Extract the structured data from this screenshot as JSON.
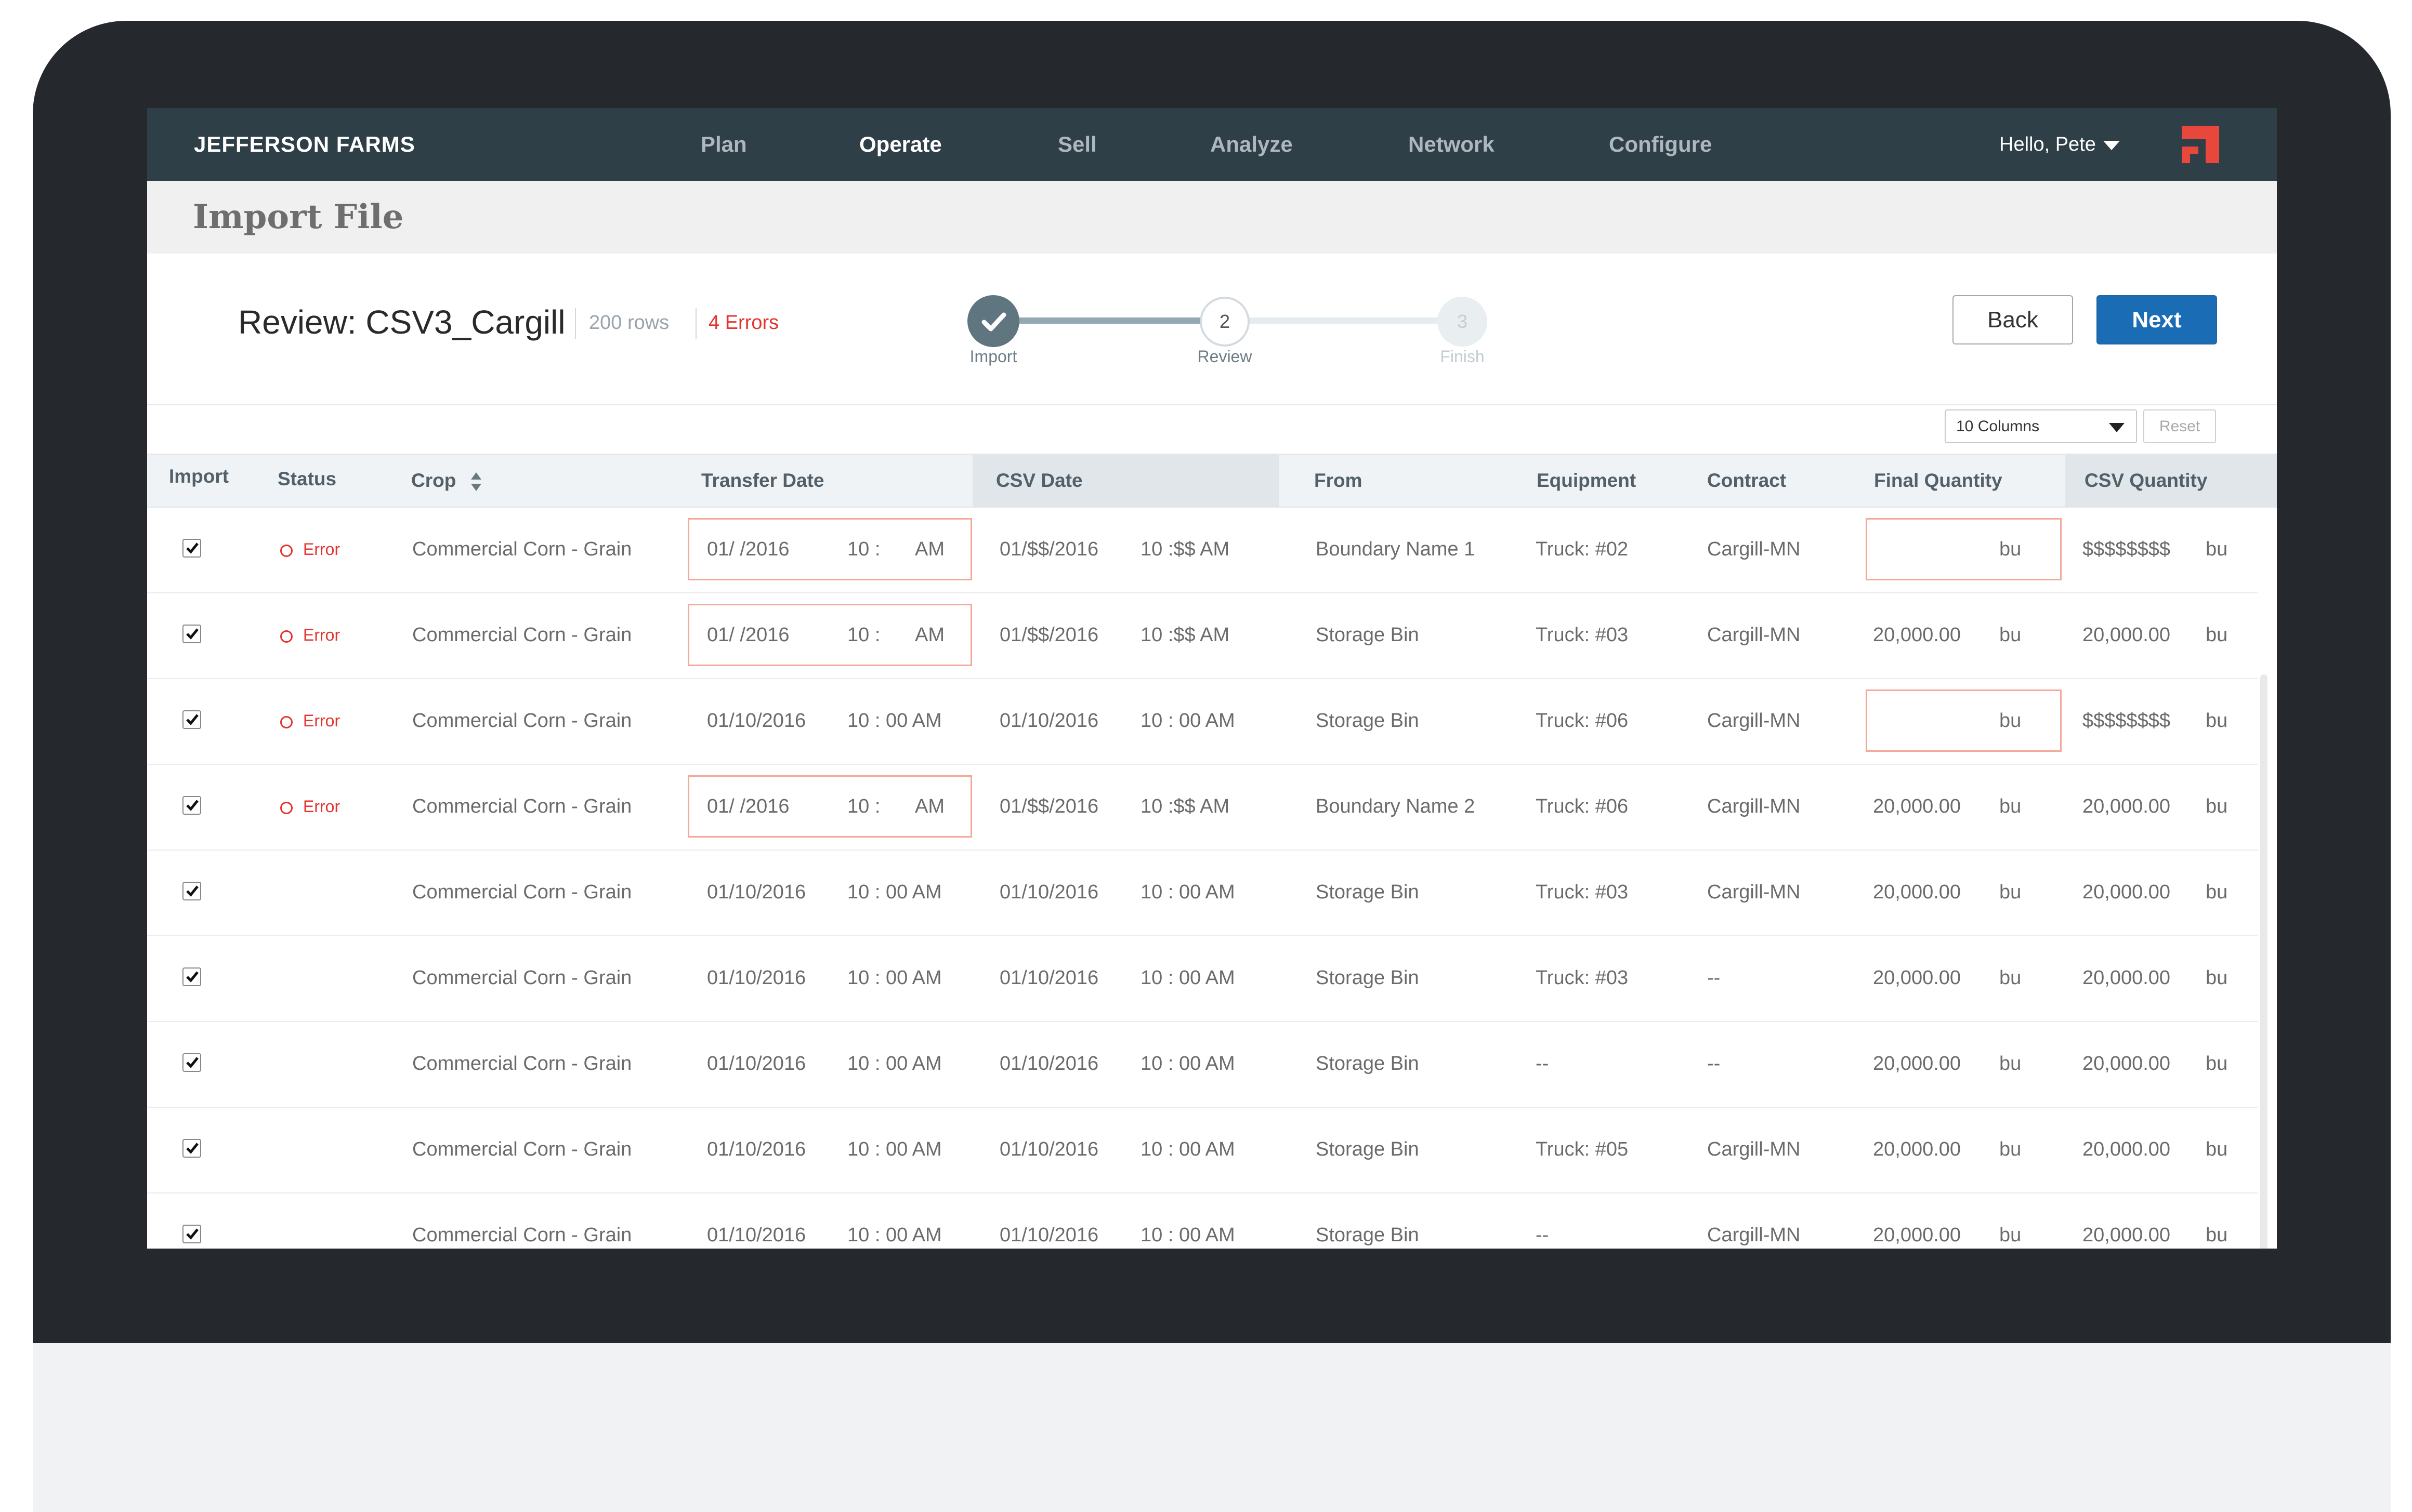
{
  "nav": {
    "brand": "JEFFERSON FARMS",
    "items": [
      {
        "label": "Plan",
        "active": false
      },
      {
        "label": "Operate",
        "active": true
      },
      {
        "label": "Sell",
        "active": false
      },
      {
        "label": "Analyze",
        "active": false
      },
      {
        "label": "Network",
        "active": false
      },
      {
        "label": "Configure",
        "active": false
      }
    ],
    "user_greeting": "Hello, Pete"
  },
  "page": {
    "title": "Import File"
  },
  "review": {
    "title": "Review: CSV3_Cargill",
    "rows_count": "200 rows",
    "errors_count": "4 Errors",
    "steps": [
      {
        "number": "",
        "label": "Import",
        "state": "done"
      },
      {
        "number": "2",
        "label": "Review",
        "state": "current"
      },
      {
        "number": "3",
        "label": "Finish",
        "state": "upcoming"
      }
    ],
    "back_label": "Back",
    "next_label": "Next"
  },
  "toolbar": {
    "columns_selected": "10 Columns",
    "reset_label": "Reset"
  },
  "table": {
    "columns": [
      "Import",
      "Status",
      "Crop",
      "Transfer Date",
      "CSV Date",
      "From",
      "Equipment",
      "Contract",
      "Final Quantity",
      "CSV Quantity"
    ],
    "rows": [
      {
        "checked": true,
        "status": "Error",
        "crop": "Commercial Corn - Grain",
        "transfer_error": true,
        "transfer_date": "01/   /2016",
        "transfer_time": "10 :",
        "transfer_ampm": "AM",
        "csv_date": "01/$$/2016",
        "csv_time": "10 :$$  AM",
        "from": "Boundary Name 1",
        "equipment": "Truck: #02",
        "contract": "Cargill-MN",
        "final_error": true,
        "final_qty": "",
        "final_unit": "bu",
        "csv_qty": "$$$$$$$$",
        "csv_unit": "bu"
      },
      {
        "checked": true,
        "status": "Error",
        "crop": "Commercial Corn - Grain",
        "transfer_error": true,
        "transfer_date": "01/   /2016",
        "transfer_time": "10 :",
        "transfer_ampm": "AM",
        "csv_date": "01/$$/2016",
        "csv_time": "10 :$$  AM",
        "from": "Storage Bin",
        "equipment": "Truck: #03",
        "contract": "Cargill-MN",
        "final_error": false,
        "final_qty": "20,000.00",
        "final_unit": "bu",
        "csv_qty": "20,000.00",
        "csv_unit": "bu"
      },
      {
        "checked": true,
        "status": "Error",
        "crop": "Commercial Corn - Grain",
        "transfer_error": false,
        "transfer_date": "01/10/2016",
        "transfer_time": "10 : 00 AM",
        "transfer_ampm": "",
        "csv_date": "01/10/2016",
        "csv_time": "10 : 00 AM",
        "from": "Storage Bin",
        "equipment": "Truck: #06",
        "contract": "Cargill-MN",
        "final_error": true,
        "final_qty": "",
        "final_unit": "bu",
        "csv_qty": "$$$$$$$$",
        "csv_unit": "bu"
      },
      {
        "checked": true,
        "status": "Error",
        "crop": "Commercial Corn - Grain",
        "transfer_error": true,
        "transfer_date": "01/   /2016",
        "transfer_time": "10 :",
        "transfer_ampm": "AM",
        "csv_date": "01/$$/2016",
        "csv_time": "10 :$$  AM",
        "from": "Boundary Name 2",
        "equipment": "Truck: #06",
        "contract": "Cargill-MN",
        "final_error": false,
        "final_qty": "20,000.00",
        "final_unit": "bu",
        "csv_qty": "20,000.00",
        "csv_unit": "bu"
      },
      {
        "checked": true,
        "status": "",
        "crop": "Commercial Corn - Grain",
        "transfer_error": false,
        "transfer_date": "01/10/2016",
        "transfer_time": "10 : 00 AM",
        "transfer_ampm": "",
        "csv_date": "01/10/2016",
        "csv_time": "10 : 00 AM",
        "from": "Storage Bin",
        "equipment": "Truck: #03",
        "contract": "Cargill-MN",
        "final_error": false,
        "final_qty": "20,000.00",
        "final_unit": "bu",
        "csv_qty": "20,000.00",
        "csv_unit": "bu"
      },
      {
        "checked": true,
        "status": "",
        "crop": "Commercial Corn - Grain",
        "transfer_error": false,
        "transfer_date": "01/10/2016",
        "transfer_time": "10 : 00 AM",
        "transfer_ampm": "",
        "csv_date": "01/10/2016",
        "csv_time": "10 : 00 AM",
        "from": "Storage Bin",
        "equipment": "Truck: #03",
        "contract": "--",
        "final_error": false,
        "final_qty": "20,000.00",
        "final_unit": "bu",
        "csv_qty": "20,000.00",
        "csv_unit": "bu"
      },
      {
        "checked": true,
        "status": "",
        "crop": "Commercial Corn - Grain",
        "transfer_error": false,
        "transfer_date": "01/10/2016",
        "transfer_time": "10 : 00 AM",
        "transfer_ampm": "",
        "csv_date": "01/10/2016",
        "csv_time": "10 : 00 AM",
        "from": "Storage Bin",
        "equipment": "--",
        "contract": "--",
        "final_error": false,
        "final_qty": "20,000.00",
        "final_unit": "bu",
        "csv_qty": "20,000.00",
        "csv_unit": "bu"
      },
      {
        "checked": true,
        "status": "",
        "crop": "Commercial Corn - Grain",
        "transfer_error": false,
        "transfer_date": "01/10/2016",
        "transfer_time": "10 : 00 AM",
        "transfer_ampm": "",
        "csv_date": "01/10/2016",
        "csv_time": "10 : 00 AM",
        "from": "Storage Bin",
        "equipment": "Truck: #05",
        "contract": "Cargill-MN",
        "final_error": false,
        "final_qty": "20,000.00",
        "final_unit": "bu",
        "csv_qty": "20,000.00",
        "csv_unit": "bu"
      },
      {
        "checked": true,
        "status": "",
        "crop": "Commercial Corn - Grain",
        "transfer_error": false,
        "transfer_date": "01/10/2016",
        "transfer_time": "10 : 00 AM",
        "transfer_ampm": "",
        "csv_date": "01/10/2016",
        "csv_time": "10 : 00 AM",
        "from": "Storage Bin",
        "equipment": "--",
        "contract": "Cargill-MN",
        "final_error": false,
        "final_qty": "20,000.00",
        "final_unit": "bu",
        "csv_qty": "20,000.00",
        "csv_unit": "bu"
      }
    ]
  },
  "colors": {
    "nav_bg": "#2f3f48",
    "accent_blue": "#1a6cb5",
    "error_red": "#e3342f",
    "error_border": "#f4a89a",
    "device_frame": "#25282d"
  },
  "icons": [
    "caret-down-icon",
    "brand-logo-icon",
    "check-icon",
    "sort-icon",
    "error-circle-icon",
    "checkbox-check-icon"
  ]
}
